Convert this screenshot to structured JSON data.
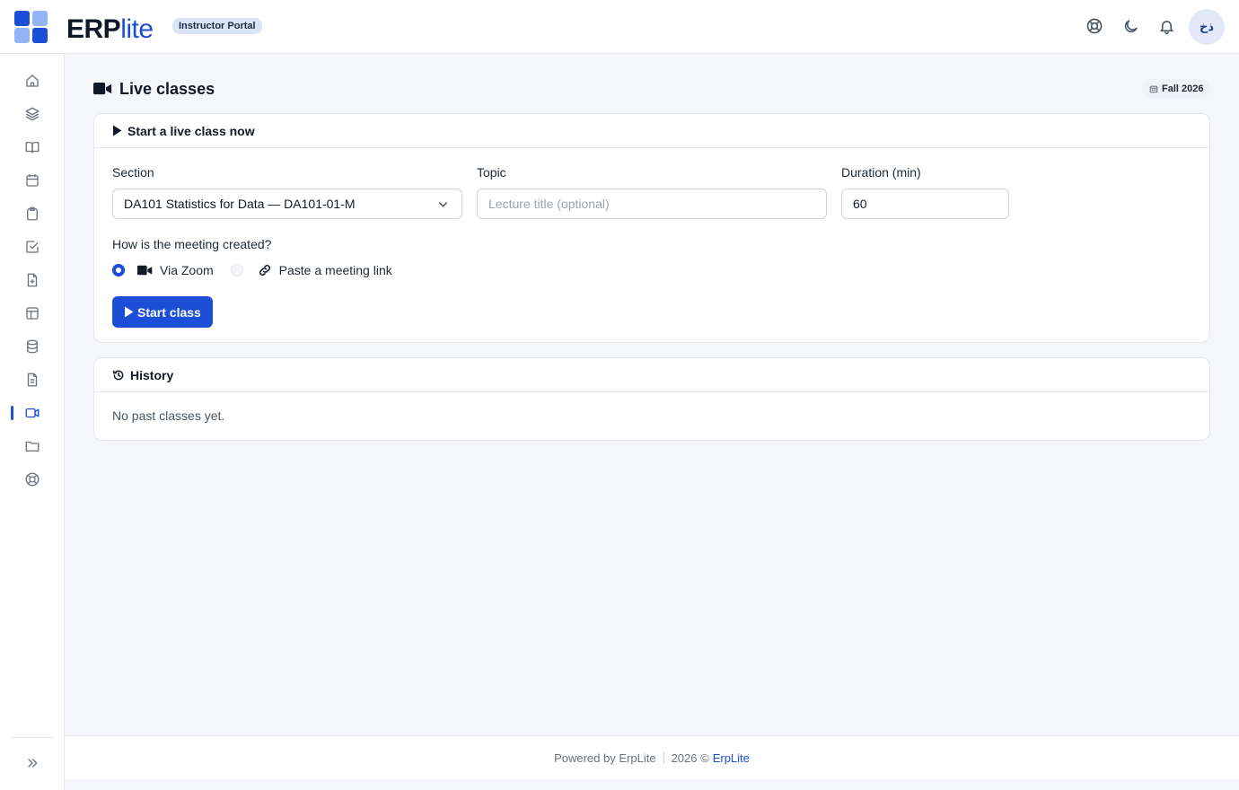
{
  "header": {
    "brand_main": "ERP",
    "brand_accent": "lite",
    "portal_badge": "Instructor Portal",
    "avatar_initials": "ذخ",
    "icons": [
      "lifebuoy-icon",
      "moon-icon",
      "bell-icon"
    ]
  },
  "sidebar": {
    "items": [
      {
        "icon": "home-icon"
      },
      {
        "icon": "layers-icon"
      },
      {
        "icon": "book-icon"
      },
      {
        "icon": "calendar-icon"
      },
      {
        "icon": "clipboard-icon"
      },
      {
        "icon": "check-square-icon"
      },
      {
        "icon": "file-plus-icon"
      },
      {
        "icon": "layout-icon"
      },
      {
        "icon": "database-icon"
      },
      {
        "icon": "file-text-icon"
      },
      {
        "icon": "video-icon",
        "active": true
      },
      {
        "icon": "folder-icon"
      },
      {
        "icon": "lifebuoy-icon"
      }
    ],
    "collapse_icon": "chevrons-right-icon"
  },
  "page": {
    "title": "Live classes",
    "term": "Fall 2026"
  },
  "start_card": {
    "title": "Start a live class now",
    "section_label": "Section",
    "section_value": "DA101 Statistics for Data — DA101-01-M",
    "topic_label": "Topic",
    "topic_placeholder": "Lecture title (optional)",
    "duration_label": "Duration (min)",
    "duration_value": "60",
    "method_question": "How is the meeting created?",
    "option_zoom": "Via Zoom",
    "option_link": "Paste a meeting link",
    "selected_option": "Via Zoom",
    "start_button": "Start class"
  },
  "history_card": {
    "title": "History",
    "empty_text": "No past classes yet."
  },
  "footer": {
    "powered_by": "Powered by ErpLite",
    "copyright": "2026 ©",
    "link": "ErpLite"
  },
  "colors": {
    "accent": "#1d4ed8",
    "background": "#f4f6fa"
  }
}
